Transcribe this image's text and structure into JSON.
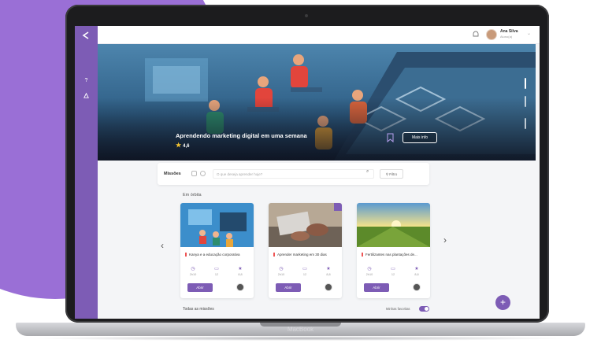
{
  "device": {
    "label": "MacBook"
  },
  "user": {
    "name": "Ana Silva",
    "role": "Aluno(a)"
  },
  "hero": {
    "title": "Aprendendo marketing digital em uma semana",
    "rating": "4,6",
    "more_button": "Mais info"
  },
  "missions": {
    "title": "Missões",
    "search_placeholder": "O que deseja aprender hoje?",
    "filter_label": "Filtro"
  },
  "section_in_orbit": "Em órbita",
  "cards": [
    {
      "title": "Kanya e a educação corporativa",
      "stat1": "2h10",
      "stat2": "12",
      "stat3": "8,8",
      "button": "Abrir"
    },
    {
      "title": "Aprender marketing em 30 dias",
      "stat1": "2h10",
      "stat2": "12",
      "stat3": "8,8",
      "button": "Abrir"
    },
    {
      "title": "Fertilizantes nas plantações de...",
      "stat1": "2h10",
      "stat2": "12",
      "stat3": "8,8",
      "button": "Abrir"
    }
  ],
  "all_missions": "Todas as missões",
  "favorites_toggle": "Minhas favoritas",
  "colors": {
    "accent": "#7d5cb5",
    "background_blob": "#9a6fd6"
  },
  "icons": [
    "logo-icon",
    "help-icon",
    "rocket-icon",
    "bell-icon",
    "search-icon",
    "filter-icon",
    "bookmark-icon",
    "star-icon",
    "clock-icon",
    "chat-icon",
    "medal-icon",
    "plus-icon",
    "chevron-left-icon",
    "chevron-right-icon"
  ]
}
